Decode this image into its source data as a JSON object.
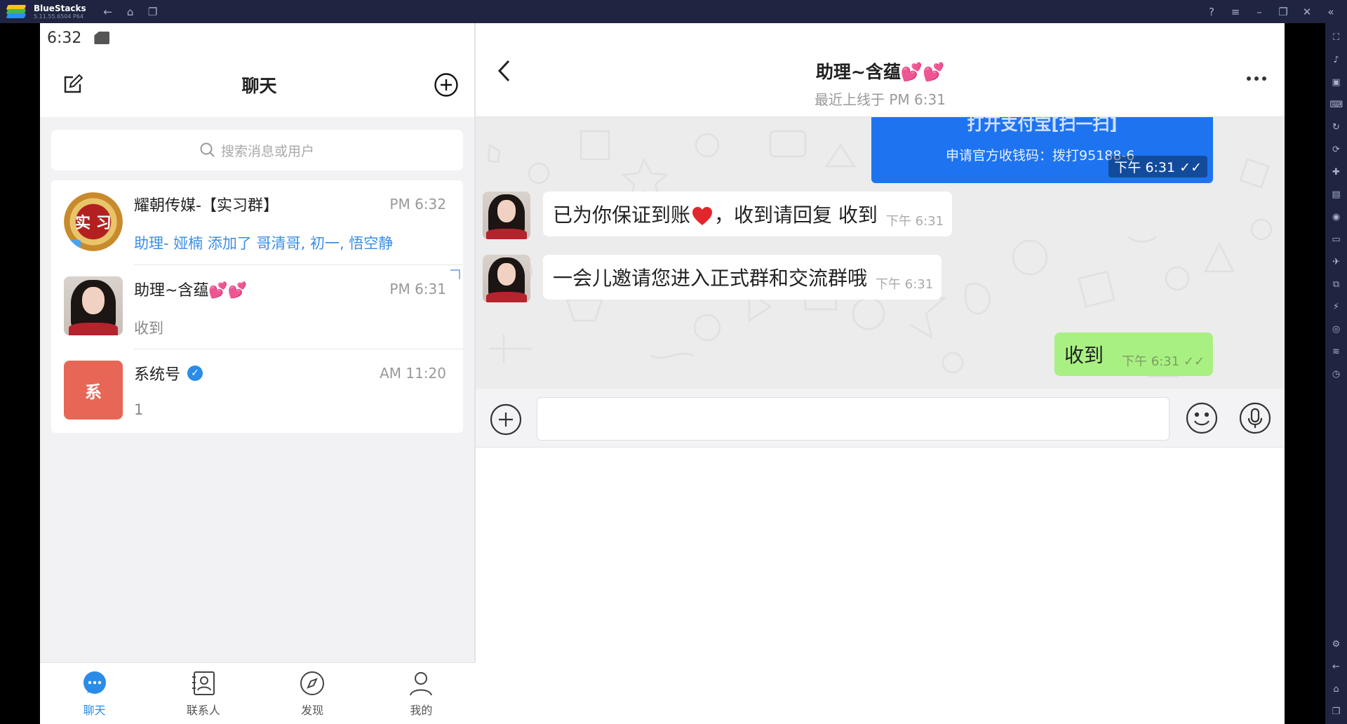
{
  "window": {
    "app_name": "BlueStacks",
    "version": "5.11.55.6504 P64"
  },
  "status_bar": {
    "time": "6:32"
  },
  "left_pane": {
    "title": "聊天",
    "search_placeholder": "搜索消息或用户",
    "chats": [
      {
        "name": "耀朝传媒-【实习群】",
        "time": "PM 6:32",
        "preview": "助理- 娅楠 添加了 哥清哥, 初一, 悟空静",
        "avatar_text": "实 习"
      },
      {
        "name": "助理~含蕴💕💕",
        "time": "PM 6:31",
        "preview": "收到"
      },
      {
        "name": "系统号",
        "time": "AM 11:20",
        "preview": "1",
        "avatar_text": "系"
      }
    ],
    "tabs": [
      {
        "label": "聊天",
        "icon": "chat-bubble-icon",
        "active": true
      },
      {
        "label": "联系人",
        "icon": "contacts-icon",
        "active": false
      },
      {
        "label": "发现",
        "icon": "compass-icon",
        "active": false
      },
      {
        "label": "我的",
        "icon": "person-icon",
        "active": false
      }
    ]
  },
  "conversation": {
    "title": "助理~含蕴💕💕",
    "subtitle": "最近上线于 PM 6:31",
    "messages": [
      {
        "side": "out",
        "style": "blue",
        "line1": "打开支付宝[扫一扫]",
        "line2": "申请官方收钱码：拨打95188-6",
        "time": "下午 6:31 ✓✓"
      },
      {
        "side": "in",
        "text_before": "已为你保证到账",
        "text_after": "，收到请回复   收到",
        "time": "下午 6:31"
      },
      {
        "side": "in",
        "text": "一会儿邀请您进入正式群和交流群哦",
        "time": "下午 6:31"
      },
      {
        "side": "out",
        "style": "green",
        "text": "收到",
        "time": "下午 6:31 ✓✓"
      }
    ],
    "input_value": ""
  },
  "colors": {
    "accent_blue": "#2a8ce8",
    "bubble_blue": "#1e74f0",
    "bubble_green": "#a9f083",
    "system_avatar": "#e86655",
    "bluestacks_chrome": "#1f2540"
  }
}
